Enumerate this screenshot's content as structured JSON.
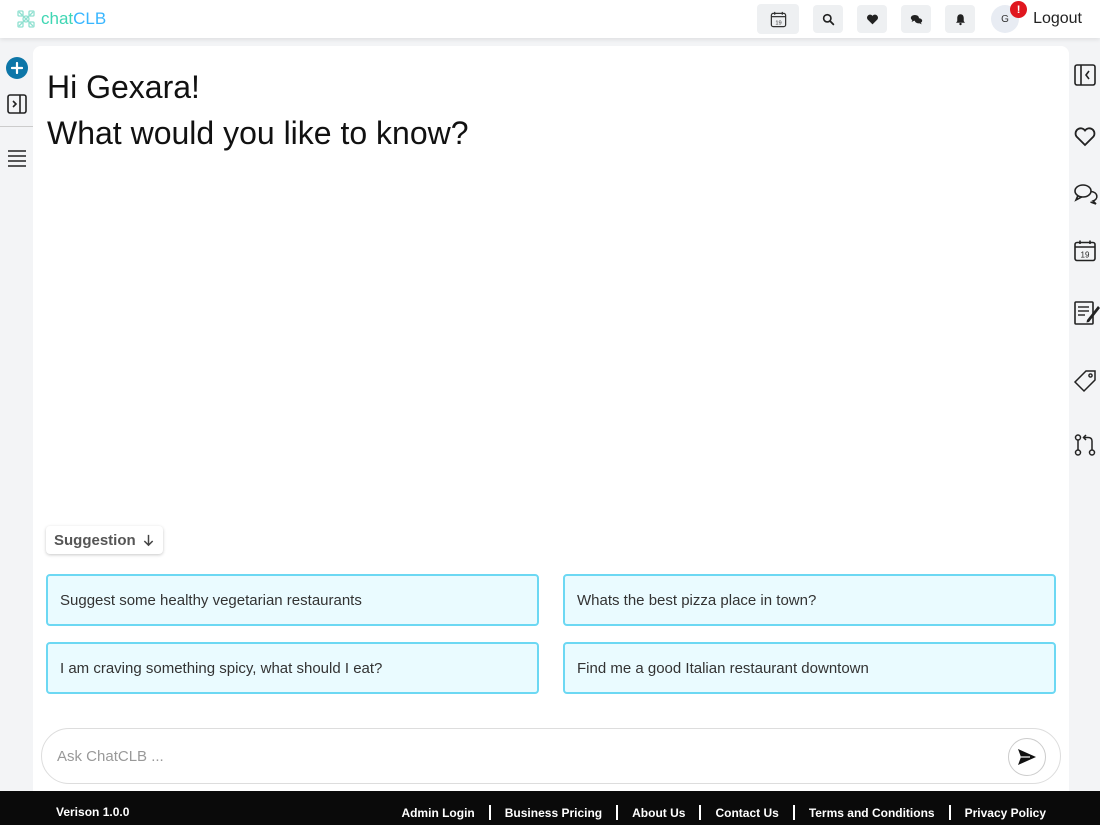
{
  "brand": {
    "chat": "chat",
    "clb": "CLB"
  },
  "topbar": {
    "avatar_initial": "G",
    "notification_count": "!",
    "logout_label": "Logout",
    "icons": [
      "calendar-icon",
      "search-icon",
      "heart-icon",
      "chat-icon",
      "bell-icon"
    ]
  },
  "main": {
    "greeting": "Hi Gexara!",
    "question": "What would you like to know?",
    "suggestion_label": "Suggestion",
    "suggestions": [
      "Suggest some healthy vegetarian restaurants",
      "Whats the best pizza place in town?",
      "I am craving something spicy, what should I eat?",
      "Find me a good Italian restaurant downtown"
    ],
    "ask_placeholder": "Ask ChatCLB ..."
  },
  "footer": {
    "version": "Verison 1.0.0",
    "links": [
      "Admin Login",
      "Business Pricing",
      "About Us",
      "Contact Us",
      "Terms and Conditions",
      "Privacy Policy"
    ]
  },
  "colors": {
    "accent": "#0d76a8",
    "suggestion_bg": "#eafbff",
    "suggestion_border": "#6cd8f3",
    "badge": "#e0171f",
    "footer_bg": "#0a0a0a"
  }
}
